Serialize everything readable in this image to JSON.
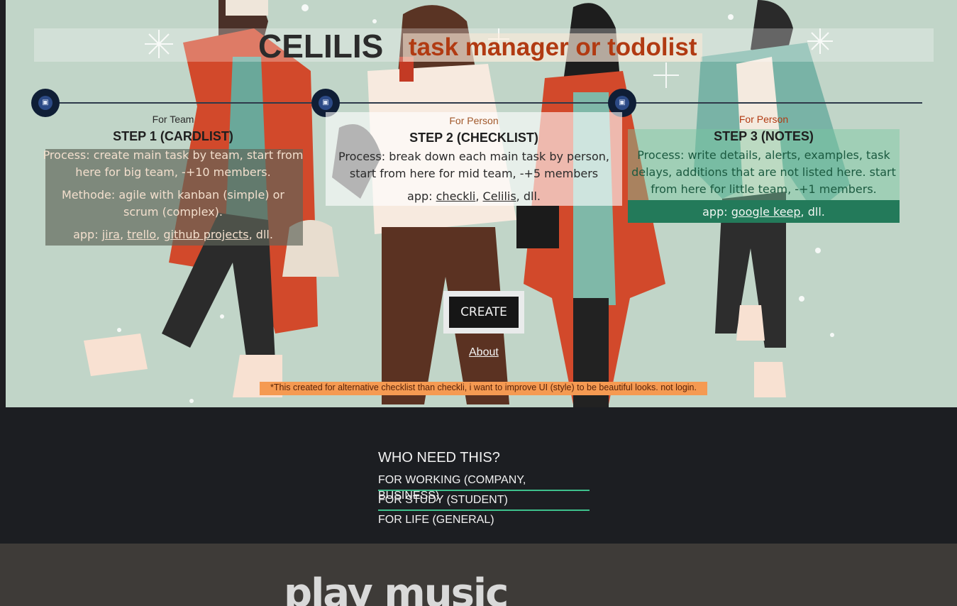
{
  "header": {
    "brand": "CELILIS",
    "tagline": "task manager or todolist"
  },
  "steps": [
    {
      "for": "For Team",
      "name": "STEP 1 (CARDLIST)",
      "process": "Process: create main task by team, start from here for big team, -+10 members.",
      "method": "Methode: agile with kanban (simple) or scrum (complex).",
      "app_prefix": "app:",
      "links": [
        "jira",
        "trello",
        "github projects"
      ],
      "app_suffix": ", dll."
    },
    {
      "for": "For Person",
      "name": "STEP 2 (CHECKLIST)",
      "process": "Process: break down each main task by person, start from here for mid team, -+5 members",
      "app_prefix": "app:",
      "links": [
        "checkli",
        "Celilis"
      ],
      "app_suffix": ", dll."
    },
    {
      "for": "For Person",
      "name": "STEP 3 (NOTES)",
      "process": "Process: write details, alerts, examples, task delays, additions that are not listed here. start from here for little team, -+1 members.",
      "app_prefix": "app:",
      "links": [
        "google keep"
      ],
      "app_suffix": ", dll."
    }
  ],
  "actions": {
    "create_label": "CREATE",
    "about_label": "About"
  },
  "note": "*This created for alternative checklist than checkli, i want to improve UI (style) to be beautiful looks. not login.",
  "who": {
    "title": "WHO NEED THIS?",
    "items": [
      "FOR WORKING (COMPANY, BUSINESS)",
      "FOR STUDY (STUDENT)",
      "FOR LIFE (GENERAL)"
    ]
  },
  "music": {
    "title": "play  music"
  },
  "colors": {
    "hero_bg": "#c1d5c8",
    "accent_orange": "#b13a12",
    "accent_green": "#3ec18c",
    "note_bg": "#f59a52"
  },
  "icons": [
    "clipboard-icon"
  ]
}
